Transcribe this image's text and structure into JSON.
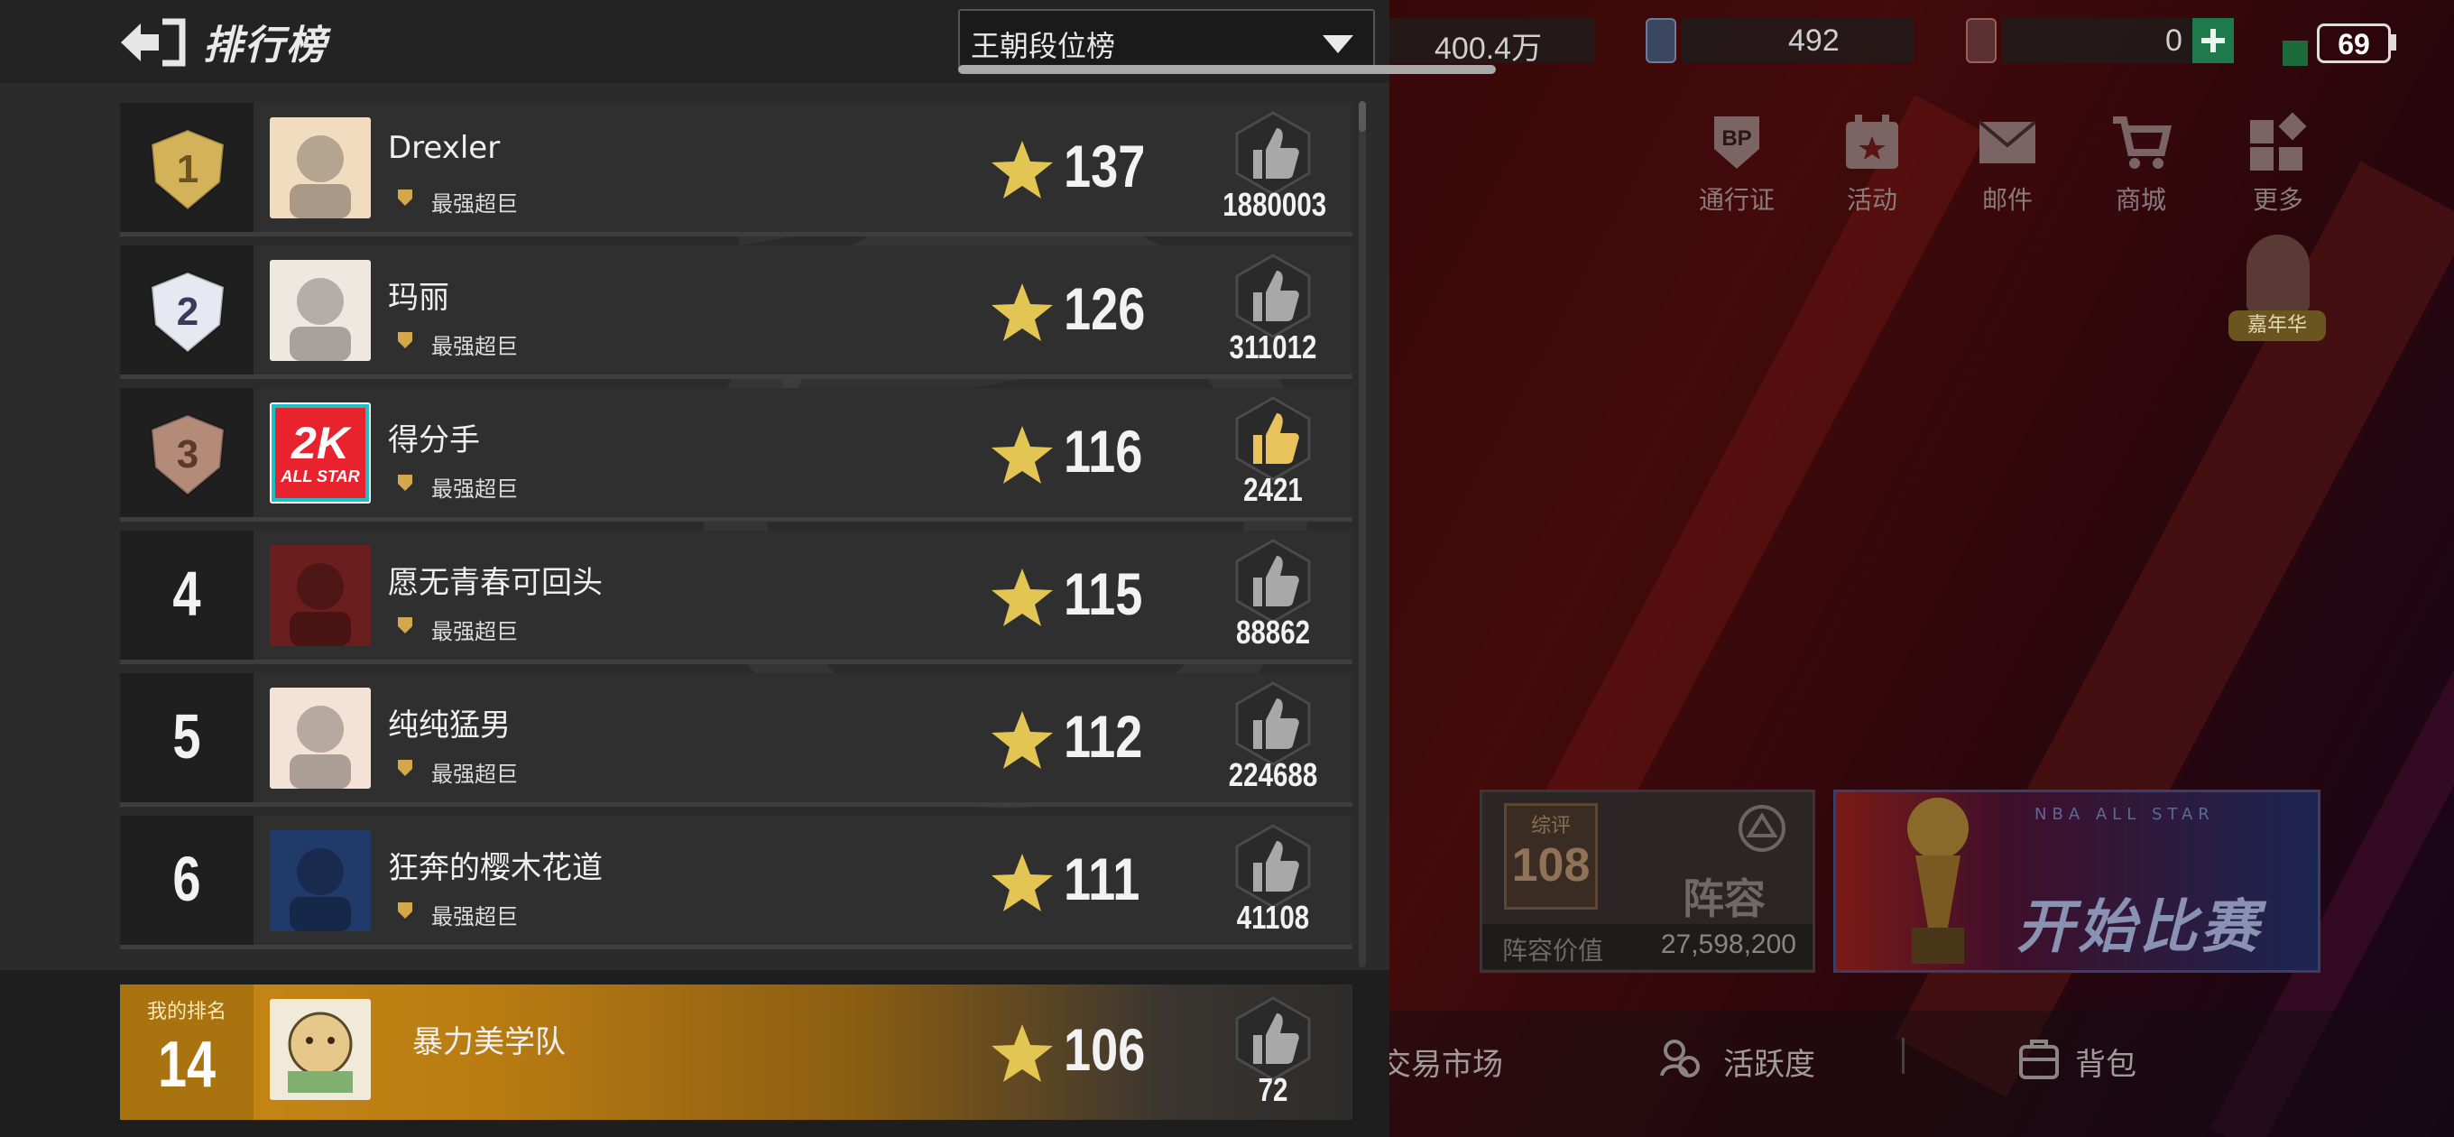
{
  "header": {
    "title": "排行榜",
    "selected_board": "王朝段位榜"
  },
  "top_bar": {
    "coins": "400.4万",
    "gems": "492",
    "tokens": "0",
    "battery": "69"
  },
  "menu": [
    {
      "label": "通行证",
      "icon": "pass-bp-icon"
    },
    {
      "label": "活动",
      "icon": "calendar-star-icon"
    },
    {
      "label": "邮件",
      "icon": "mail-icon"
    },
    {
      "label": "商城",
      "icon": "cart-icon"
    },
    {
      "label": "更多",
      "icon": "more-grid-icon"
    }
  ],
  "carnival_label": "嘉年华",
  "lineup_card": {
    "rating_label": "综评",
    "rating": "108",
    "title": "阵容",
    "value_label": "阵容价值",
    "value": "27,598,200"
  },
  "start_button": {
    "label": "开始比赛",
    "bg_text": "NBA ALL STAR"
  },
  "bottom_nav": [
    {
      "label": "交易市场",
      "icon": "market-icon"
    },
    {
      "label": "活跃度",
      "icon": "activity-icon"
    },
    {
      "label": "背包",
      "icon": "backpack-icon"
    }
  ],
  "leaderboard": {
    "rows": [
      {
        "rank": "1",
        "name": "Drexler",
        "title": "最强超巨",
        "score": "137",
        "likes": "1880003"
      },
      {
        "rank": "2",
        "name": "玛丽",
        "title": "最强超巨",
        "score": "126",
        "likes": "311012"
      },
      {
        "rank": "3",
        "name": "得分手",
        "title": "最强超巨",
        "score": "116",
        "likes": "2421"
      },
      {
        "rank": "4",
        "name": "愿无青春可回头",
        "title": "最强超巨",
        "score": "115",
        "likes": "88862"
      },
      {
        "rank": "5",
        "name": "纯纯猛男",
        "title": "最强超巨",
        "score": "112",
        "likes": "224688"
      },
      {
        "rank": "6",
        "name": "狂奔的樱木花道",
        "title": "最强超巨",
        "score": "111",
        "likes": "41108"
      }
    ],
    "my_rank": {
      "label": "我的排名",
      "rank": "14",
      "name": "暴力美学队",
      "score": "106",
      "likes": "72"
    }
  },
  "colors": {
    "gold": "#d4b25a",
    "silver": "#e8e8f2",
    "bronze": "#b48a78",
    "star": "#e2c552",
    "my_row": "#c88a16"
  }
}
